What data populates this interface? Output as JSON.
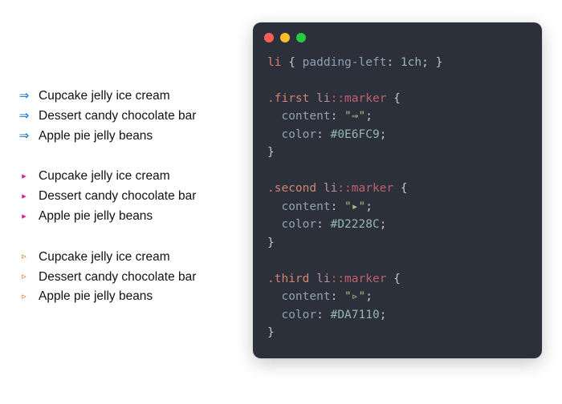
{
  "lists": {
    "first": {
      "marker_glyph": "⇒",
      "marker_color": "#0E6FC9",
      "items": [
        "Cupcake jelly ice cream",
        "Dessert candy chocolate bar",
        "Apple pie jelly beans"
      ]
    },
    "second": {
      "marker_glyph": "▸",
      "marker_color": "#D2228C",
      "items": [
        "Cupcake jelly ice cream",
        "Dessert candy chocolate bar",
        "Apple pie jelly beans"
      ]
    },
    "third": {
      "marker_glyph": "▹",
      "marker_color": "#DA7110",
      "items": [
        "Cupcake jelly ice cream",
        "Dessert candy chocolate bar",
        "Apple pie jelly beans"
      ]
    }
  },
  "code": {
    "rule0": {
      "selector": "li",
      "prop": "padding-left",
      "value": "1ch"
    },
    "rules": [
      {
        "class_sel": ".first",
        "desc": "li",
        "pseudo": "::marker",
        "content": "\"⇒\"",
        "color": "#0E6FC9"
      },
      {
        "class_sel": ".second",
        "desc": "li",
        "pseudo": "::marker",
        "content": "\"▸\"",
        "color": "#D2228C"
      },
      {
        "class_sel": ".third",
        "desc": "li",
        "pseudo": "::marker",
        "content": "\"▹\"",
        "color": "#DA7110"
      }
    ],
    "prop_content": "content",
    "prop_color": "color"
  }
}
